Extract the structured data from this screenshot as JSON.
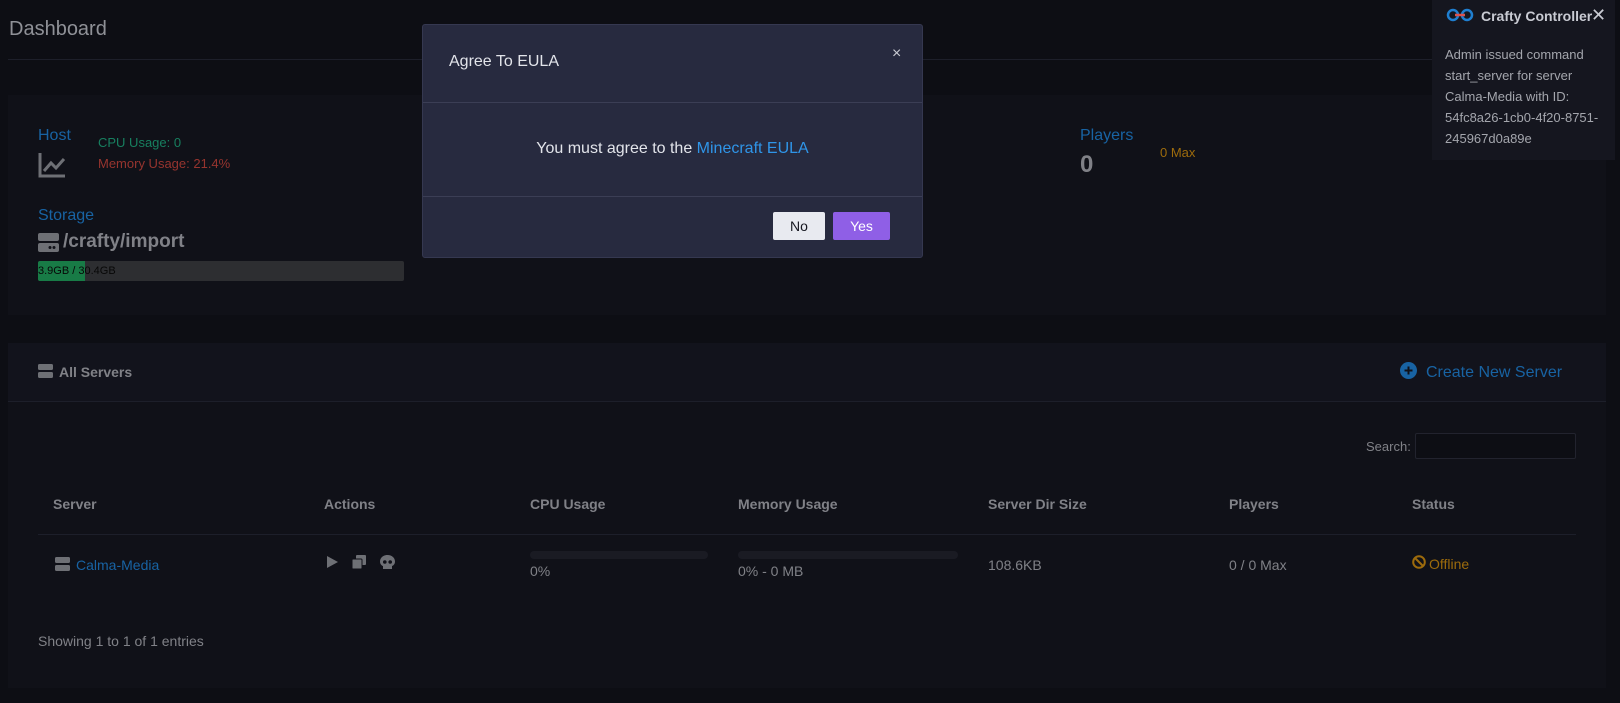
{
  "page": {
    "title": "Dashboard"
  },
  "stats": {
    "host_label": "Host",
    "cpu_usage": "CPU Usage: 0",
    "memory_usage": "Memory Usage: 21.4%",
    "storage_label": "Storage",
    "storage_path": "/crafty/import",
    "storage_usage": "3.9GB / 30.4GB",
    "storage_fraction": 0.128,
    "players_label": "Players",
    "players_count": "0",
    "players_max": "0 Max"
  },
  "servers": {
    "header_label": "All Servers",
    "create_label": "Create New Server",
    "search_label": "Search:",
    "search_value": "",
    "columns": [
      "Server",
      "Actions",
      "CPU Usage",
      "Memory Usage",
      "Server Dir Size",
      "Players",
      "Status"
    ],
    "rows": [
      {
        "name": "Calma-Media",
        "cpu": "0%",
        "memory": "0% - 0 MB",
        "dir_size": "108.6KB",
        "players": "0 / 0 Max",
        "status": "Offline"
      }
    ],
    "footer": "Showing 1 to 1 of 1 entries"
  },
  "modal": {
    "title": "Agree To EULA",
    "close_label": "×",
    "body_prefix": "You must agree to the ",
    "link_text": "Minecraft EULA",
    "no_label": "No",
    "yes_label": "Yes"
  },
  "toast": {
    "title": "Crafty Controller",
    "close_label": "✕",
    "message": "Admin issued command start_server for server Calma-Media with ID: 54fc8a26-1cb0-4f20-8751-245967d0a89e"
  },
  "colors": {
    "accent": "#1f7fd1",
    "success": "#1ea37a",
    "danger": "#c0433c",
    "warning": "#c98a10",
    "primary_button": "#8f5fe6"
  },
  "icons": [
    "line-chart-icon",
    "hard-drive-icon",
    "server-icon",
    "plus-circle-icon",
    "play-icon",
    "clone-icon",
    "skull-icon",
    "ban-icon",
    "link-icon"
  ]
}
